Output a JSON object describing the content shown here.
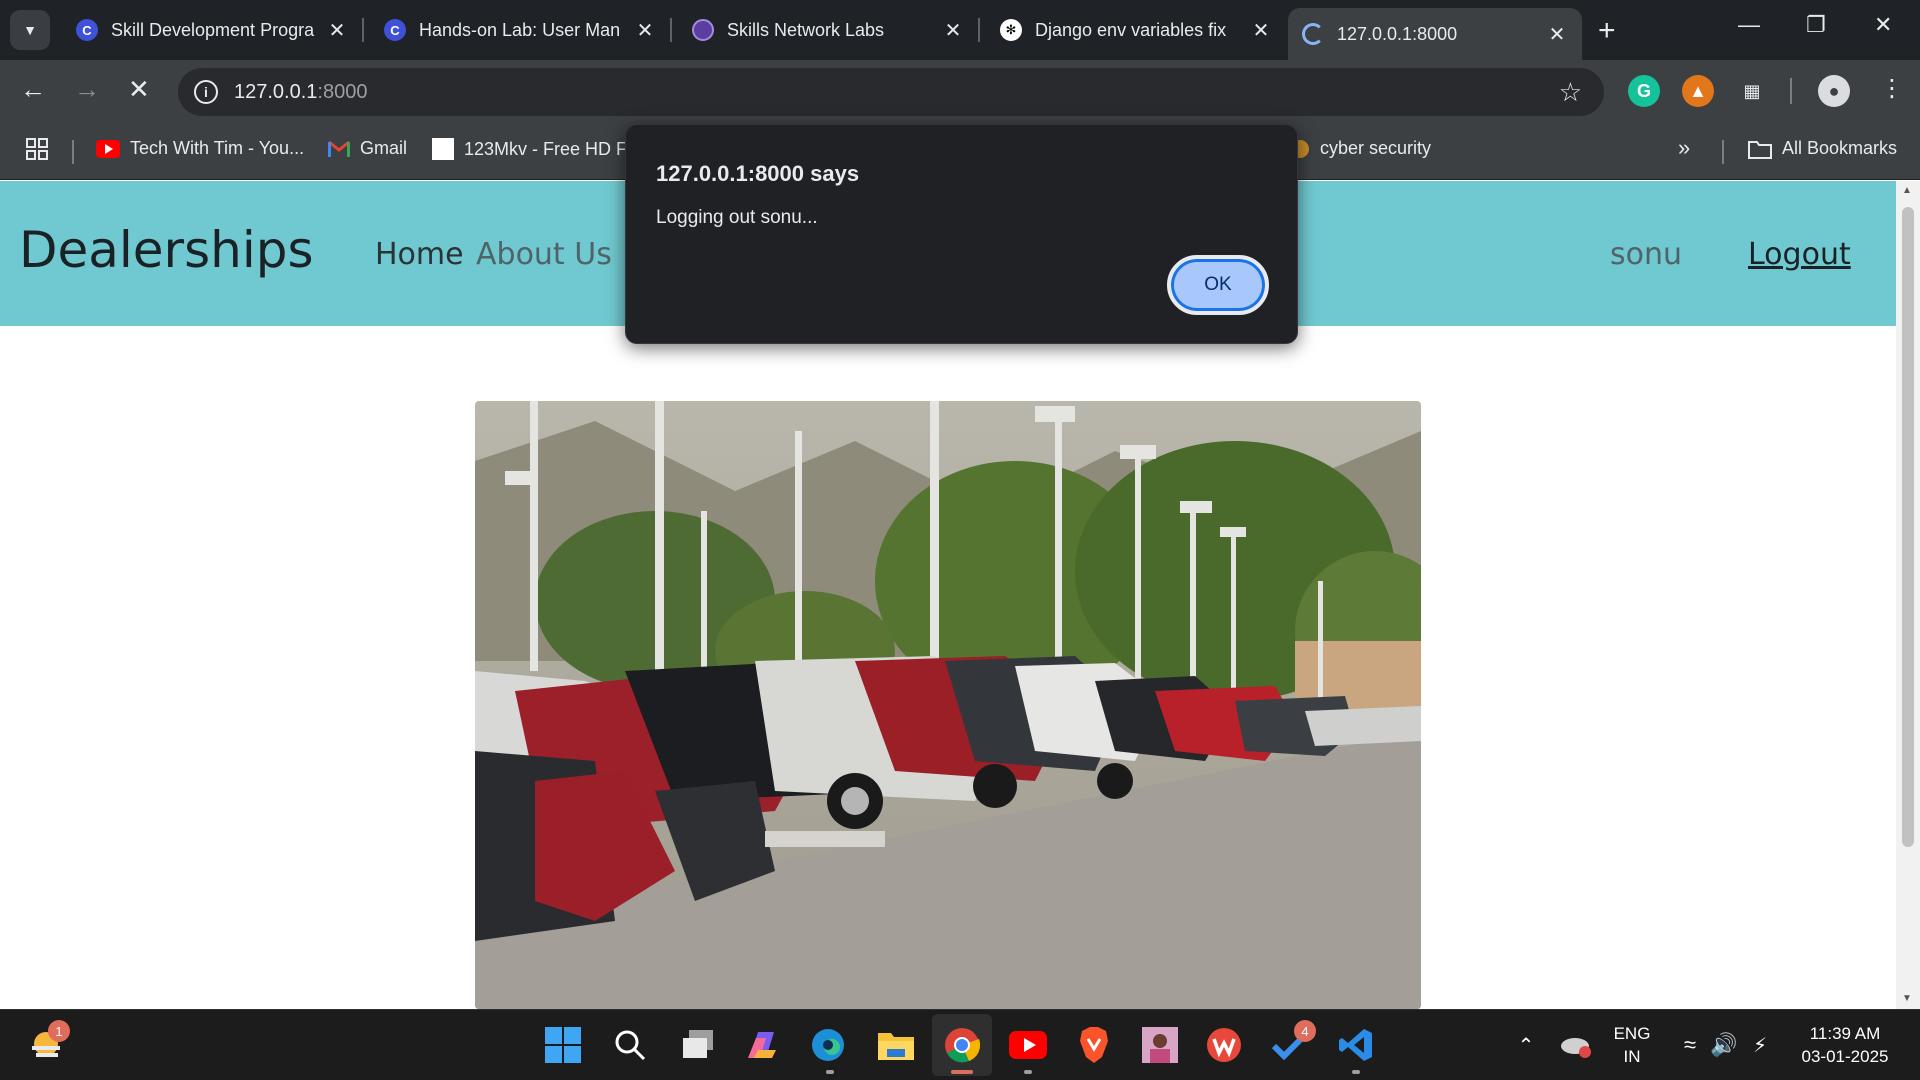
{
  "browser": {
    "tabs": [
      {
        "title": "Skill Development Progra",
        "favicon": "coursera-c-icon"
      },
      {
        "title": "Hands-on Lab: User Man",
        "favicon": "coursera-c-icon"
      },
      {
        "title": "Skills Network Labs",
        "favicon": "skills-network-icon"
      },
      {
        "title": "Django env variables fix",
        "favicon": "chatgpt-icon"
      },
      {
        "title": "127.0.0.1:8000",
        "favicon": "loading-spinner-icon",
        "active": true
      }
    ],
    "url_host": "127.0.0.1",
    "url_port": ":8000",
    "bookmarks": [
      {
        "label": "Tech With Tim - You...",
        "icon": "youtube-icon"
      },
      {
        "label": "Gmail",
        "icon": "gmail-icon"
      },
      {
        "label": "123Mkv - Free HD F...",
        "icon": "page-icon"
      },
      {
        "label": "cyber security",
        "icon": "bookmark-icon"
      }
    ],
    "all_bookmarks_label": "All Bookmarks",
    "overflow_label": "»"
  },
  "site": {
    "brand": "Dealerships",
    "nav": [
      {
        "label": "Home"
      },
      {
        "label": "About Us"
      }
    ],
    "username": "sonu",
    "logout_label": "Logout",
    "hero_alt": "Cars parked at a dealership lot"
  },
  "dialog": {
    "title": "127.0.0.1:8000 says",
    "message": "Logging out sonu...",
    "ok_label": "OK"
  },
  "taskbar": {
    "weather_badge": "1",
    "todo_badge": "4",
    "lang_line1": "ENG",
    "lang_line2": "IN",
    "time": "11:39 AM",
    "date": "03-01-2025"
  },
  "colors": {
    "navbar": "#70c9d0",
    "dialog_bg": "#202124",
    "ok_button": "#a8c7fa"
  }
}
